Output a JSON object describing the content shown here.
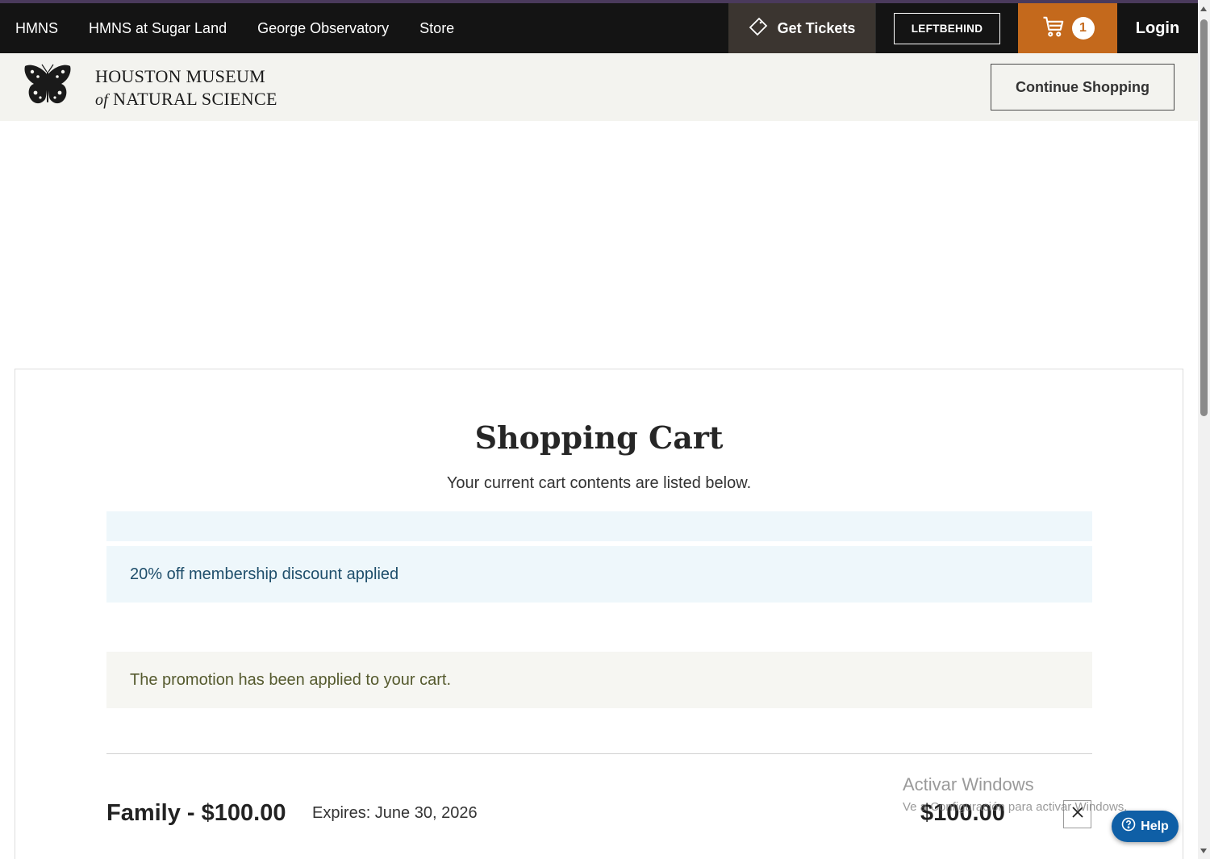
{
  "topnav": {
    "links": [
      "HMNS",
      "HMNS at Sugar Land",
      "George Observatory",
      "Store"
    ],
    "get_tickets_label": "Get Tickets",
    "leftbehind_label": "LEFTBEHIND",
    "cart_count": "1",
    "login_label": "Login",
    "cart_color": "#c4691c"
  },
  "header": {
    "logo_line1": "HOUSTON MUSEUM",
    "logo_of": "of",
    "logo_line2": "NATURAL SCIENCE",
    "continue_label": "Continue Shopping"
  },
  "cart": {
    "title": "Shopping Cart",
    "subtitle": "Your current cart contents are listed below.",
    "discount_message": "20% off membership discount applied",
    "promo_message": "The promotion has been applied to your cart.",
    "item": {
      "name": "Family - $100.00",
      "expires": "Expires: June 30, 2026",
      "price": "$100.00"
    }
  },
  "watermark": {
    "line1": "Activar Windows",
    "line2": "Ve a Configuración para activar Windows."
  },
  "help": {
    "label": "Help"
  }
}
